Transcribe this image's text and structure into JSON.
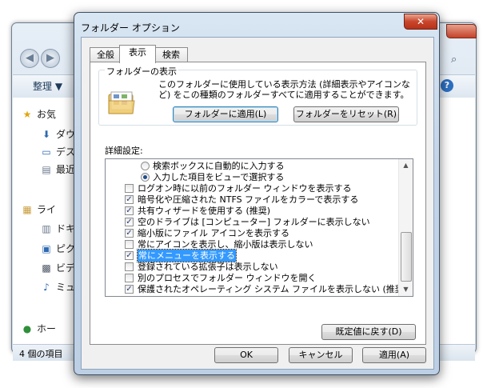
{
  "explorer": {
    "organize_label": "整理 ▼",
    "status_text": "4 個の項目",
    "nav_items": [
      {
        "icon": "star-icon",
        "glyph": "★",
        "label": "お気"
      },
      {
        "icon": "download-folder-icon",
        "glyph": "⬇",
        "label": "ダウ"
      },
      {
        "icon": "desktop-icon",
        "glyph": "▭",
        "label": "デス"
      },
      {
        "icon": "recent-places-icon",
        "glyph": "▤",
        "label": "最近"
      },
      {
        "icon": "library-icon",
        "glyph": "▦",
        "label": "ライ"
      },
      {
        "icon": "documents-icon",
        "glyph": "▥",
        "label": "ドキ"
      },
      {
        "icon": "pictures-icon",
        "glyph": "▣",
        "label": "ピク"
      },
      {
        "icon": "videos-icon",
        "glyph": "▩",
        "label": "ビデ"
      },
      {
        "icon": "music-icon",
        "glyph": "♪",
        "label": "ミュ"
      },
      {
        "icon": "homegroup-icon",
        "glyph": "●",
        "label": "ホー"
      }
    ]
  },
  "dialog": {
    "title": "フォルダー オプション",
    "tabs": [
      {
        "label": "全般",
        "active": false
      },
      {
        "label": "表示",
        "active": true
      },
      {
        "label": "検索",
        "active": false
      }
    ],
    "folder_views": {
      "legend": "フォルダーの表示",
      "description": "このフォルダーに使用している表示方法 (詳細表示やアイコンなど) をこの種類のフォルダーすべてに適用することができます。",
      "apply_button": "フォルダーに適用(L)",
      "reset_button": "フォルダーをリセット(R)"
    },
    "advanced_label": "詳細設定:",
    "advanced_items": [
      {
        "kind": "radio",
        "checked": false,
        "label": "検索ボックスに自動的に入力する"
      },
      {
        "kind": "radio",
        "checked": true,
        "label": "入力した項目をビューで選択する"
      },
      {
        "kind": "check",
        "checked": false,
        "label": "ログオン時に以前のフォルダー ウィンドウを表示する"
      },
      {
        "kind": "check",
        "checked": true,
        "label": "暗号化や圧縮された NTFS ファイルをカラーで表示する"
      },
      {
        "kind": "check",
        "checked": true,
        "label": "共有ウィザードを使用する (推奨)"
      },
      {
        "kind": "check",
        "checked": true,
        "label": "空のドライブは [コンピューター] フォルダーに表示しない"
      },
      {
        "kind": "check",
        "checked": true,
        "label": "縮小版にファイル アイコンを表示する"
      },
      {
        "kind": "check",
        "checked": false,
        "label": "常にアイコンを表示し、縮小版は表示しない"
      },
      {
        "kind": "check",
        "checked": true,
        "label": "常にメニューを表示する",
        "selected": true
      },
      {
        "kind": "check",
        "checked": false,
        "label": "登録されている拡張子は表示しない"
      },
      {
        "kind": "check",
        "checked": false,
        "label": "別のプロセスでフォルダー ウィンドウを開く"
      },
      {
        "kind": "check",
        "checked": true,
        "label": "保護されたオペレーティング システム ファイルを表示しない (推奨)"
      }
    ],
    "restore_defaults_button": "既定値に戻す(D)",
    "ok_button": "OK",
    "cancel_button": "キャンセル",
    "apply_button": "適用(A)"
  }
}
